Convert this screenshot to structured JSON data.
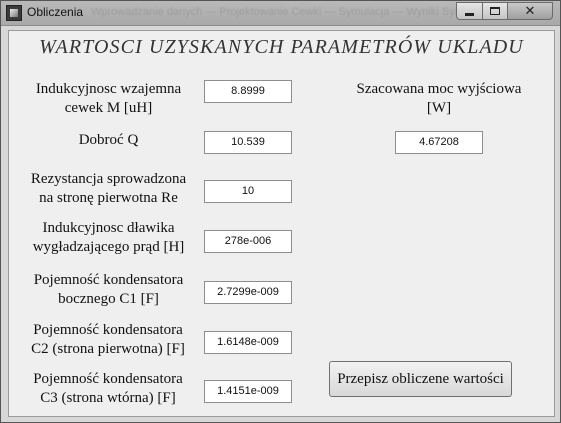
{
  "window": {
    "title": "Obliczenia",
    "background_title_text": "Wprowadzanie danych — Projektowanie Cewki — Symulacja — Wyniki Symulacji"
  },
  "heading": "WARTOSCI UZYSKANYCH PARAMETRÓW UKLADU",
  "fields": [
    {
      "label_line1": "Indukcyjnosc wzajemna",
      "label_line2": "cewek M [uH]",
      "value": "8.8999"
    },
    {
      "label_line1": "Dobroć Q",
      "label_line2": "",
      "value": "10.539"
    },
    {
      "label_line1": "Rezystancja sprowadzona",
      "label_line2": "na stronę pierwotna Re",
      "value": "10"
    },
    {
      "label_line1": "Indukcyjnosc dławika",
      "label_line2": "wygładzającego prąd [H]",
      "value": "278e-006"
    },
    {
      "label_line1": "Pojemność kondensatora",
      "label_line2": "bocznego C1 [F]",
      "value": "2.7299e-009"
    },
    {
      "label_line1": "Pojemność kondensatora",
      "label_line2": "C2 (strona pierwotna) [F]",
      "value": "1.6148e-009"
    },
    {
      "label_line1": "Pojemność kondensatora",
      "label_line2": "C3 (strona wtórna) [F]",
      "value": "1.4151e-009"
    }
  ],
  "power": {
    "label_line1": "Szacowana moc wyjściowa",
    "label_line2": "[W]",
    "value": "4.67208"
  },
  "copy_button_label": "Przepisz obliczene wartości",
  "icons": {
    "app": "matlab-figure-icon",
    "minimize": "minimize-icon",
    "maximize": "maximize-icon",
    "close": "close-icon"
  }
}
